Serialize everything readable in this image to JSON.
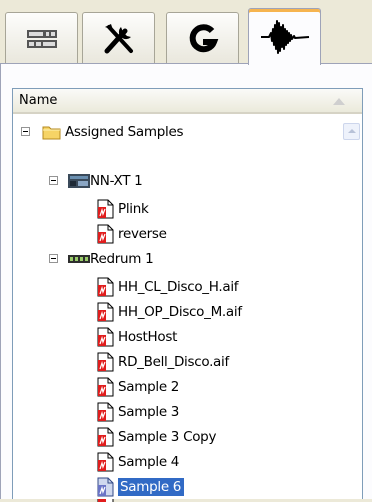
{
  "tabs": [
    {
      "name": "rack-icon",
      "active": false
    },
    {
      "name": "tools-icon",
      "active": false
    },
    {
      "name": "groove-icon",
      "active": false
    },
    {
      "name": "waveform-icon",
      "active": true
    }
  ],
  "tree": {
    "header": {
      "label": "Name"
    },
    "root": {
      "label": "Assigned Samples",
      "icon": "folder-icon"
    },
    "devices": [
      {
        "label": "NN-XT 1",
        "icon": "nnxt-device-icon",
        "samples": [
          "Plink",
          "reverse"
        ]
      },
      {
        "label": "Redrum 1",
        "icon": "redrum-device-icon",
        "samples": [
          "HH_CL_Disco_H.aif",
          "HH_OP_Disco_M.aif",
          "HostHost",
          "RD_Bell_Disco.aif",
          "Sample 2",
          "Sample 3",
          "Sample 3 Copy",
          "Sample 4",
          "Sample 6"
        ]
      }
    ],
    "selected": "Sample 6"
  }
}
